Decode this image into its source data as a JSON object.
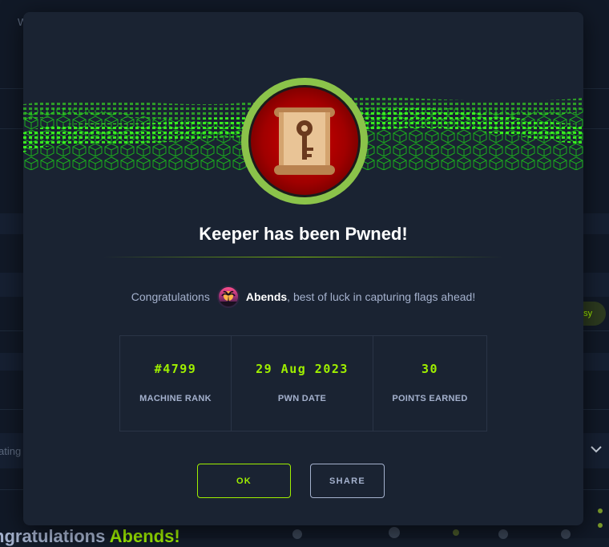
{
  "background": {
    "top_left_text": "W",
    "filter_text": "ating",
    "difficulty_badge": "asy",
    "bottom_text_prefix": "ngratulations ",
    "bottom_text_name": "Abends!"
  },
  "modal": {
    "title": "Keeper has been Pwned!",
    "congrats_prefix": "Congratulations",
    "username": "Abends",
    "congrats_suffix": ", best of luck in capturing flags ahead!",
    "stats": [
      {
        "value": "#4799",
        "label": "MACHINE RANK"
      },
      {
        "value": "29 Aug 2023",
        "label": "PWN DATE"
      },
      {
        "value": "30",
        "label": "POINTS EARNED"
      }
    ],
    "ok_label": "OK",
    "share_label": "SHARE"
  },
  "colors": {
    "accent": "#9fef00",
    "modal_bg": "#1a2332",
    "ring": "#8bc34a",
    "text_muted": "#a4b1cd"
  },
  "icons": {
    "machine_avatar": "scroll-key-icon",
    "user_avatar": "palm-sunset-avatar",
    "background_chevron": "chevron-down-icon"
  }
}
